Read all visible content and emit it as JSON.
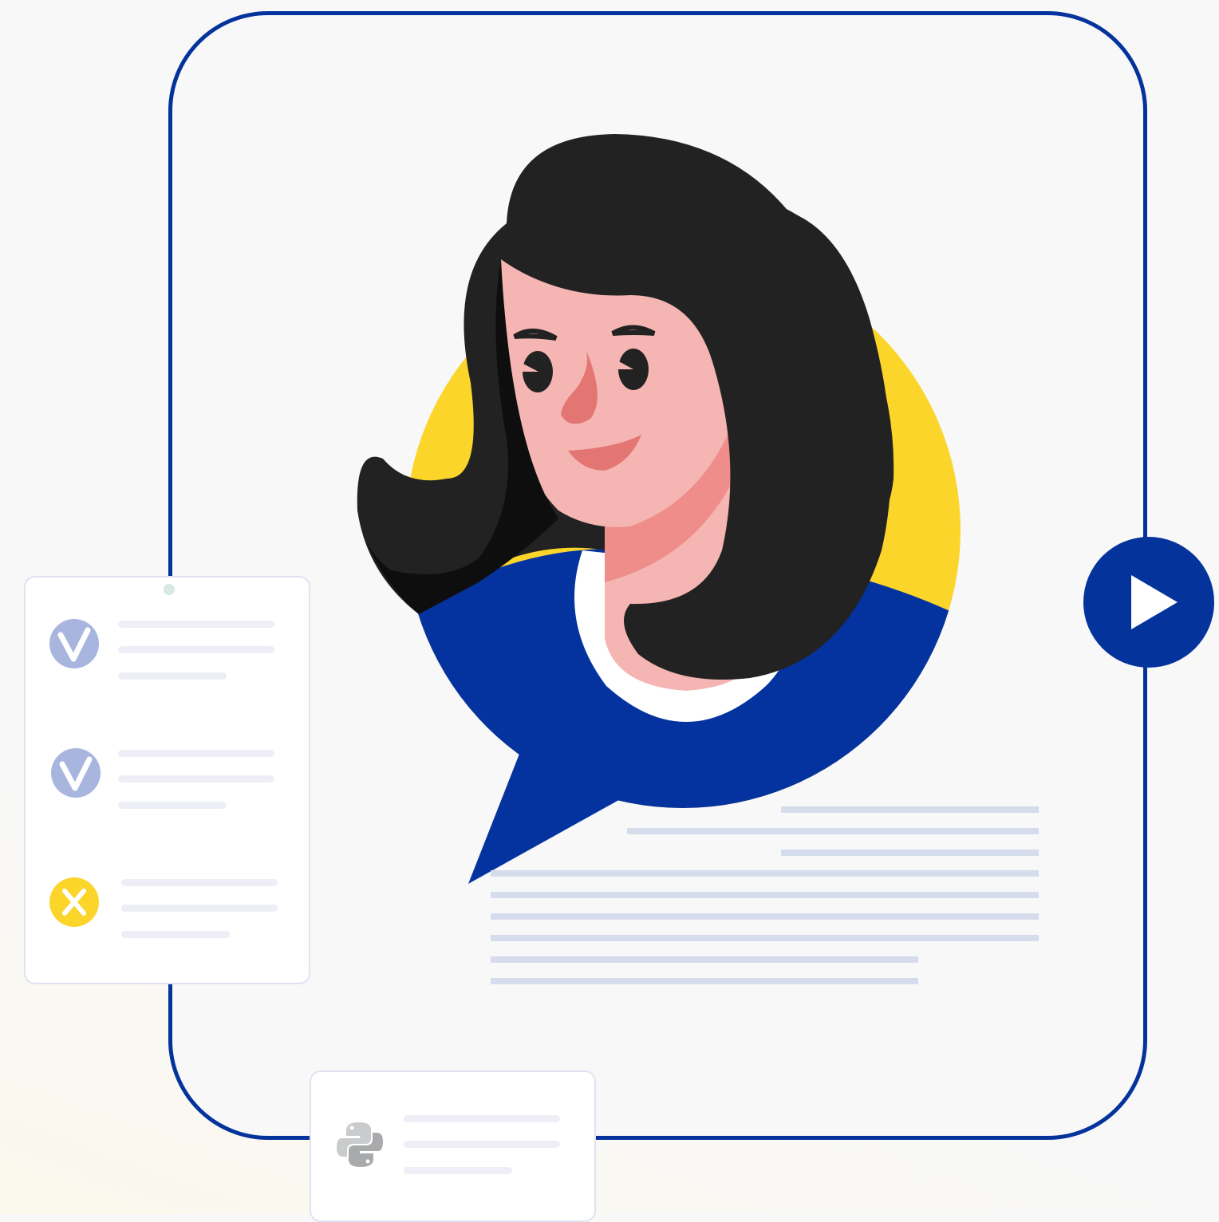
{
  "colors": {
    "frame_border": "#05339c",
    "accent_blue": "#05339c",
    "accent_yellow": "#fcd52b",
    "check_icon": "#a8b6df",
    "placeholder_line": "#eeeff6",
    "text_line": "#d5dcec"
  },
  "checklist": {
    "items": [
      {
        "status": "pass",
        "icon": "check-icon"
      },
      {
        "status": "pass",
        "icon": "check-icon"
      },
      {
        "status": "fail",
        "icon": "x-icon"
      }
    ]
  },
  "code_card": {
    "icon": "python-logo-icon"
  },
  "play_button": {
    "icon": "play-icon"
  },
  "avatar": {
    "description_icon": "woman-avatar-speech-bubble"
  }
}
